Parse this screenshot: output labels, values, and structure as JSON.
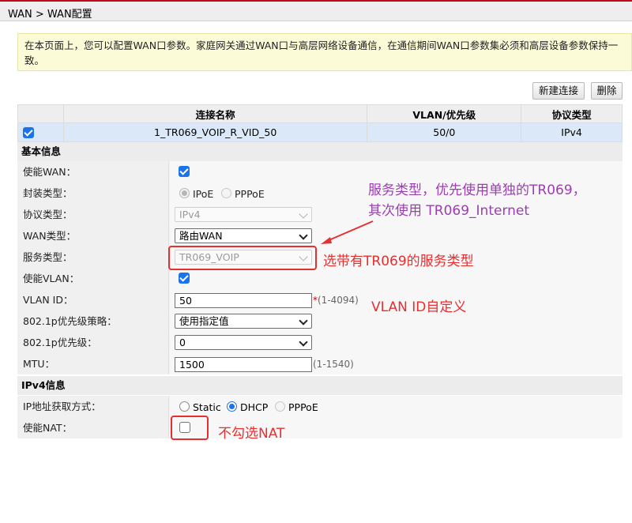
{
  "breadcrumb": "WAN > WAN配置",
  "notice": "在本页面上，您可以配置WAN口参数。家庭网关通过WAN口与高层网络设备通信，在通信期间WAN口参数集必须和高层设备参数保持一致。",
  "toolbar": {
    "new_label": "新建连接",
    "delete_label": "删除"
  },
  "list": {
    "headers": [
      "连接名称",
      "VLAN/优先级",
      "协议类型"
    ],
    "row": {
      "checked": true,
      "name": "1_TR069_VOIP_R_VID_50",
      "vlan": "50/0",
      "protocol": "IPv4"
    }
  },
  "sections": {
    "basic": "基本信息",
    "ipv4": "IPv4信息"
  },
  "fields": {
    "enable_wan": {
      "label": "使能WAN：",
      "checked": true
    },
    "encap": {
      "label": "封装类型：",
      "options": [
        "IPoE",
        "PPPoE"
      ],
      "selected": "IPoE"
    },
    "protocol": {
      "label": "协议类型：",
      "value": "IPv4"
    },
    "wan_type": {
      "label": "WAN类型：",
      "value": "路由WAN"
    },
    "service_type": {
      "label": "服务类型：",
      "value": "TR069_VOIP"
    },
    "enable_vlan": {
      "label": "使能VLAN：",
      "checked": true
    },
    "vlan_id": {
      "label": "VLAN ID：",
      "value": "50",
      "required": "*",
      "hint": "(1-4094)"
    },
    "prio_policy": {
      "label": "802.1p优先级策略：",
      "value": "使用指定值"
    },
    "prio": {
      "label": "802.1p优先级：",
      "value": "0"
    },
    "mtu": {
      "label": "MTU：",
      "value": "1500",
      "hint": "(1-1540)"
    },
    "ip_mode": {
      "label": "IP地址获取方式：",
      "options": [
        "Static",
        "DHCP",
        "PPPoE"
      ],
      "selected": "DHCP"
    },
    "enable_nat": {
      "label": "使能NAT：",
      "checked": false
    }
  },
  "annotations": {
    "service_note_line1": "服务类型，优先使用单独的TR069，",
    "service_note_line2": "其次使用 TR069_Internet",
    "service_choice": "选带有TR069的服务类型",
    "vlan_note": "VLAN ID自定义",
    "nat_note": "不勾选NAT"
  },
  "colors": {
    "accent": "#1a73e8",
    "annotation_red": "#e53030",
    "annotation_purple": "#9b3fb0",
    "notice_bg": "#fcfbd8"
  }
}
